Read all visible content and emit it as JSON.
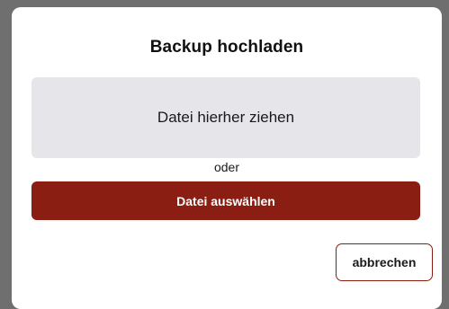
{
  "dialog": {
    "title": "Backup hochladen",
    "dropzone_text": "Datei hierher ziehen",
    "or_text": "oder",
    "choose_file_label": "Datei auswählen",
    "cancel_label": "abbrechen"
  },
  "colors": {
    "primary": "#8b1e12",
    "dropzone_bg": "#e5e5ea",
    "backdrop": "#6f6f6f"
  }
}
